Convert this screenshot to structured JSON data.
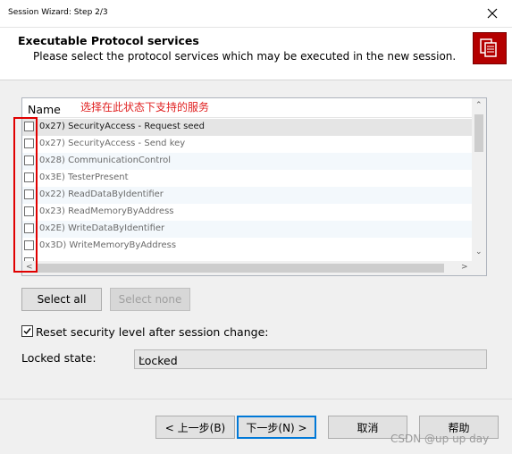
{
  "window": {
    "title": "Session Wizard: Step 2/3"
  },
  "header": {
    "title": "Executable Protocol services",
    "subtitle": "Please select the protocol services which may be executed in the new session."
  },
  "list": {
    "column_header": "Name",
    "annotation": "选择在此状态下支持的服务",
    "items": [
      {
        "label": "0x27) SecurityAccess - Request seed",
        "checked": false
      },
      {
        "label": "0x27) SecurityAccess - Send key",
        "checked": false
      },
      {
        "label": "0x28) CommunicationControl",
        "checked": false
      },
      {
        "label": "0x3E) TesterPresent",
        "checked": false
      },
      {
        "label": "0x22) ReadDataByIdentifier",
        "checked": false
      },
      {
        "label": "0x23) ReadMemoryByAddress",
        "checked": false
      },
      {
        "label": "0x2E) WriteDataByIdentifier",
        "checked": false
      },
      {
        "label": "0x3D) WriteMemoryByAddress",
        "checked": false
      }
    ]
  },
  "buttons": {
    "select_all": "Select all",
    "select_none": "Select none",
    "back": "< 上一步(B)",
    "next": "下一步(N) >",
    "cancel": "取消",
    "help": "帮助"
  },
  "options": {
    "reset_security": {
      "label": "Reset security level after session change:",
      "checked": true
    },
    "locked_state": {
      "label": "Locked state:",
      "value": "Locked"
    }
  },
  "watermark": "CSDN @up up day",
  "colors": {
    "accent": "#0078d7",
    "logo": "#b40000",
    "annotation": "#e02020"
  }
}
